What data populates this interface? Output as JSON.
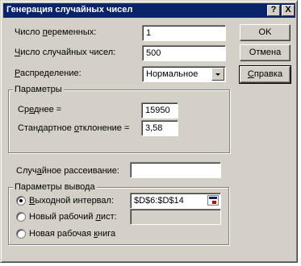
{
  "window": {
    "title": "Генерация случайных чисел",
    "help_btn": "?",
    "close_btn": "X"
  },
  "fields": {
    "num_vars": {
      "label_pre": "Число ",
      "label_ul": "п",
      "label_post": "еременных:",
      "value": "1"
    },
    "num_random": {
      "label_pre": "",
      "label_ul": "Ч",
      "label_post": "исло случайных чисел:",
      "value": "500"
    },
    "distribution": {
      "label_pre": "",
      "label_ul": "Р",
      "label_post": "аспределение:",
      "value": "Нормальное"
    }
  },
  "buttons": {
    "ok": "OK",
    "cancel": "Отмена",
    "help_pre": "",
    "help_ul": "С",
    "help_post": "правка"
  },
  "params": {
    "title": "Параметры",
    "mean": {
      "label_pre": "Ср",
      "label_ul": "е",
      "label_post": "днее =",
      "value": "15950"
    },
    "stdev": {
      "label_pre": "Стандартное ",
      "label_ul": "о",
      "label_post": "тклонение =",
      "value": "3,58"
    }
  },
  "seed": {
    "label_pre": "Случ",
    "label_ul": "а",
    "label_post": "йное рассеивание:",
    "value": ""
  },
  "output": {
    "title": "Параметры вывода",
    "range": {
      "label_pre": "",
      "label_ul": "В",
      "label_post": "ыходной интервал:",
      "value": "$D$6:$D$14",
      "checked": true
    },
    "new_sheet": {
      "label_pre": "Новый рабочий ",
      "label_ul": "л",
      "label_post": "ист:",
      "value": "",
      "checked": false
    },
    "new_book": {
      "label_pre": "Новая рабочая ",
      "label_ul": "к",
      "label_post": "нига",
      "checked": false
    }
  }
}
